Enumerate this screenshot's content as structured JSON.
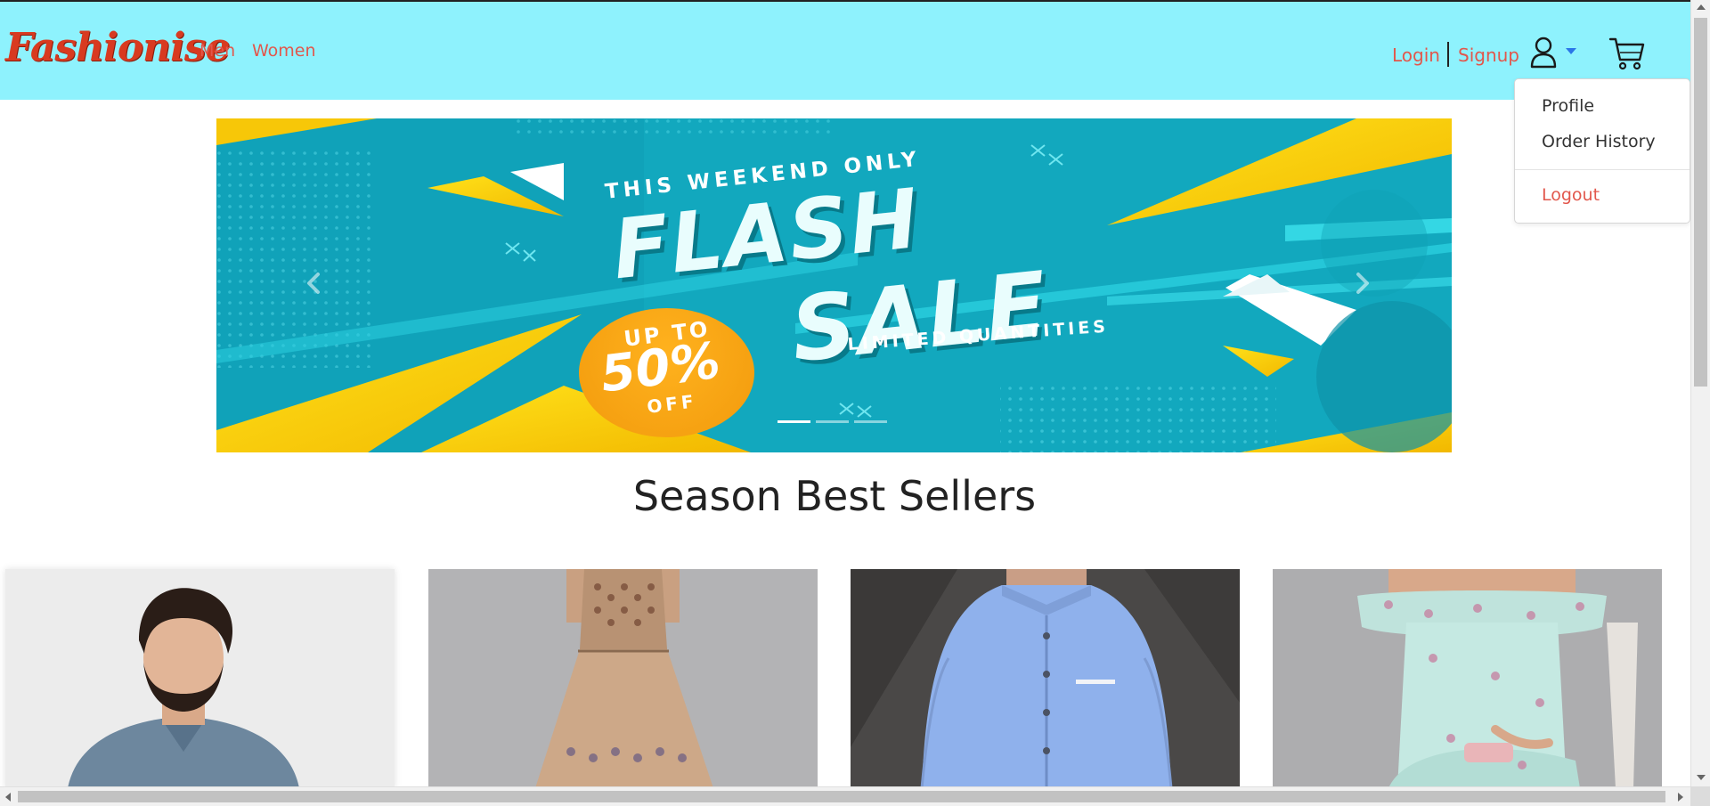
{
  "navbar": {
    "brand": "Fashionise",
    "links": {
      "men": "Men",
      "women": "Women"
    },
    "auth": {
      "login": "Login",
      "signup": "Signup"
    },
    "icons": {
      "user": "user-icon",
      "caret": "caret-down-icon",
      "cart": "cart-icon"
    },
    "background": "#8ef2fd",
    "accent": "#e2574c"
  },
  "user_menu": {
    "items": [
      {
        "label": "Profile"
      },
      {
        "label": "Order History"
      }
    ],
    "logout": "Logout"
  },
  "carousel": {
    "slide": {
      "line1": "THIS WEEKEND ONLY",
      "line2": "FLASH",
      "line3": "SALE",
      "line4": "LIMITED QUANTITIES",
      "badge": {
        "top": "UP TO",
        "value": "50%",
        "bottom": "OFF"
      }
    },
    "controls": {
      "prev": "chevron-left-icon",
      "next": "chevron-right-icon"
    },
    "indicator_count": 3,
    "active_indicator": 0,
    "colors": {
      "bg": "#12a8be",
      "yellow": "#f9d10a",
      "orange": "#f6a313"
    }
  },
  "section": {
    "title": "Season Best Sellers"
  },
  "products": [
    {
      "image": "man-in-grey-shirt"
    },
    {
      "image": "woman-in-beige-printed-dress"
    },
    {
      "image": "man-in-blue-shirt"
    },
    {
      "image": "woman-in-mint-floral-dress"
    }
  ]
}
